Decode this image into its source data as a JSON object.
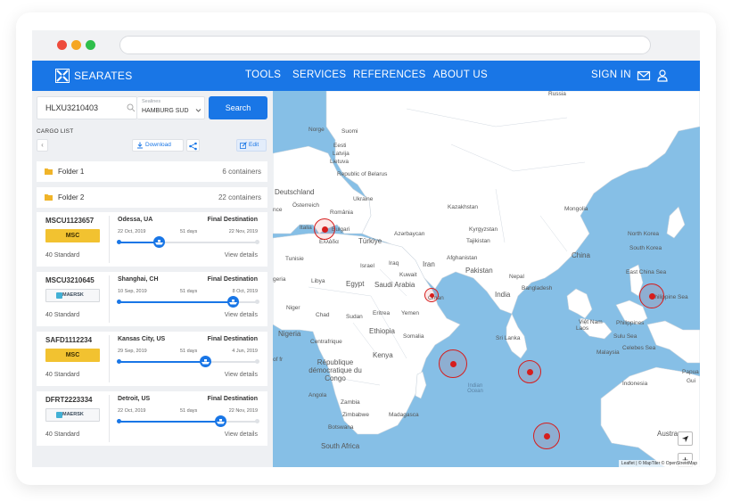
{
  "nav": {
    "brand": "SEARATES",
    "items": [
      "TOOLS",
      "SERVICES",
      "REFERENCES",
      "ABOUT US"
    ],
    "sign_in": "SIGN IN"
  },
  "search": {
    "value": "HLXU3210403",
    "sealines_label": "Sealines",
    "sealine": "HAMBURG SUD",
    "button": "Search"
  },
  "cargo": {
    "label": "CARGO LIST",
    "download": "Download",
    "edit": "Edit",
    "folders": [
      {
        "name": "Folder 1",
        "count": "6 containers"
      },
      {
        "name": "Folder 2",
        "count": "22 containers"
      }
    ],
    "containers": [
      {
        "id": "MSCU1123657",
        "carrier": "msc",
        "type": "40 Standard",
        "origin": "Odessa, UA",
        "destination": "Final Destination",
        "start": "22 Oct, 2019",
        "days": "51 days",
        "end": "22 Nov, 2019",
        "progress": 0.29,
        "details": "View details"
      },
      {
        "id": "MSCU3210645",
        "carrier": "maersk",
        "type": "40 Standard",
        "origin": "Shanghai, CH",
        "destination": "Final Destination",
        "start": "10 Sep, 2019",
        "days": "51 days",
        "end": "8 Oct, 2019",
        "progress": 0.82,
        "details": "View details"
      },
      {
        "id": "SAFD1112234",
        "carrier": "msc",
        "type": "40 Standard",
        "origin": "Kansas City, US",
        "destination": "Final Destination",
        "start": "29 Sep, 2019",
        "days": "51 days",
        "end": "4 Jun, 2019",
        "progress": 0.62,
        "details": "View details"
      },
      {
        "id": "DFRT2223334",
        "carrier": "maersk",
        "type": "40 Standard",
        "origin": "Detroit, US",
        "destination": "Final Destination",
        "start": "22 Oct, 2019",
        "days": "51 days",
        "end": "22 Nov, 2019",
        "progress": 0.73,
        "details": "View details"
      }
    ],
    "carrier_logos": {
      "msc": "MSC",
      "maersk": "MAERSK"
    }
  },
  "map": {
    "labels": {
      "russia": "Russia",
      "norge": "Norge",
      "suomi": "Suomi",
      "eesti": "Eesti",
      "latvija": "Latvija",
      "lietuva": "Lietuva",
      "belarus": "Republic of Belarus",
      "deutschland": "Deutschland",
      "france": "nce",
      "osterreich": "Österreich",
      "romania": "România",
      "ukraine": "Ukraine",
      "italia": "Italia",
      "bulgaria": "Bulgari",
      "ellada": "Ελλάδα",
      "turkiye": "Türkiye",
      "azerbaijan": "Azərbaycan",
      "kazakhstan": "Kazakhstan",
      "kyrgyzstan": "Kyrgyzstan",
      "tajikistan": "Tajikistan",
      "mongolia": "Mongolia",
      "north_korea": "North Korea",
      "south_korea": "South Korea",
      "china": "China",
      "tunisie": "Tunisie",
      "israel": "Israel",
      "iraq": "Iraq",
      "iran": "Iran",
      "afghanistan": "Afghanistan",
      "kuwait": "Kuwait",
      "pakistan": "Pakistan",
      "nepal": "Nepal",
      "libya": "Libya",
      "egypt": "Egypt",
      "saudi": "Saudi Arabia",
      "oman": "Oman",
      "india": "India",
      "bangladesh": "Bangladesh",
      "east_china_sea": "East China Sea",
      "algeria": "geria",
      "niger": "Niger",
      "chad": "Chad",
      "sudan": "Sudan",
      "eritrea": "Eritrea",
      "yemen": "Yemen",
      "laos": "Laos",
      "viet_nam": "Việt Nam",
      "philippines": "Philippines",
      "philippine_sea": "Philippine Sea",
      "nigeria": "Nigeria",
      "ethiopia": "Ethiopia",
      "somalia": "Somalia",
      "sri_lanka": "Sri Lanka",
      "sulu_sea": "Sulu Sea",
      "centrafrique": "Centrafrique",
      "kenya": "Kenya",
      "malaysia": "Malaysia",
      "celebes": "Celebes Sea",
      "indonesia": "Indonesia",
      "papua": "Papua",
      "gui": "Gui",
      "of_fr": "of fr",
      "rdc": "République démocratique du Congo",
      "indian_ocean": "Indian Ocean",
      "angola": "Angola",
      "zambia": "Zambia",
      "zimbabwe": "Zimbabwe",
      "madagascar": "Madagasca",
      "botswana": "Botswana",
      "south_africa": "South Africa",
      "australia": "Austra"
    },
    "zoom_in": "+",
    "zoom_out": "−",
    "attribution": "Leaflet | © MapTiler © OpenStreetMap",
    "accent": "#1976e6",
    "marker_color": "#d61d1d"
  }
}
